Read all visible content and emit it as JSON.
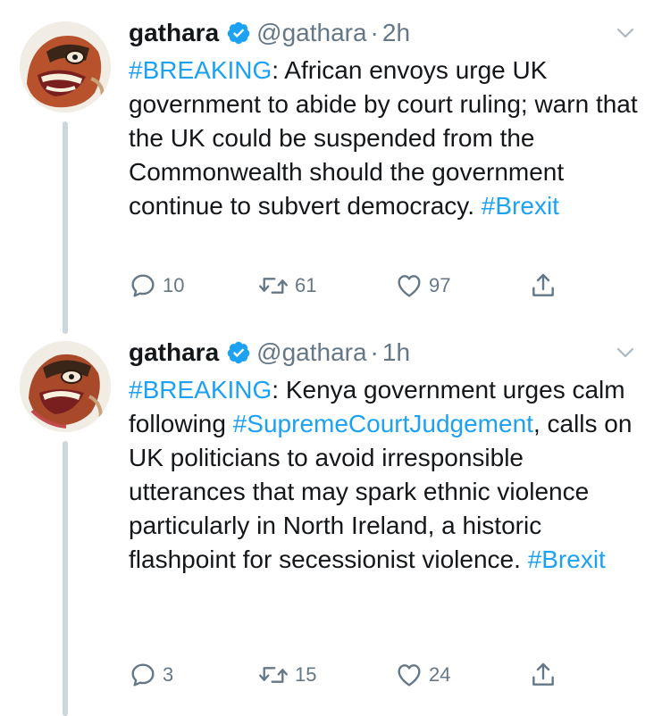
{
  "tweets": [
    {
      "name": "gathara",
      "handle": "@gathara",
      "separator": "·",
      "time": "2h",
      "segments": [
        {
          "text": "#BREAKING",
          "tag": true
        },
        {
          "text": ": African envoys urge UK government to abide by court ruling; warn that the UK could be suspended from the Commonwealth should the government continue to subvert democracy. ",
          "tag": false
        },
        {
          "text": "#Brexit",
          "tag": true
        }
      ],
      "replies": "10",
      "retweets": "61",
      "likes": "97"
    },
    {
      "name": "gathara",
      "handle": "@gathara",
      "separator": "·",
      "time": "1h",
      "segments": [
        {
          "text": "#BREAKING",
          "tag": true
        },
        {
          "text": ": Kenya government urges calm following ",
          "tag": false
        },
        {
          "text": "#SupremeCourtJudgement",
          "tag": true
        },
        {
          "text": ", calls on UK politicians to avoid irresponsible utterances that may spark ethnic violence particularly in North Ireland, a historic flashpoint for secessionist violence. ",
          "tag": false
        },
        {
          "text": "#Brexit",
          "tag": true
        }
      ],
      "replies": "3",
      "retweets": "15",
      "likes": "24"
    }
  ],
  "icons": {
    "verified": "verified-badge-icon",
    "chevron": "chevron-down-icon",
    "reply": "reply-icon",
    "retweet": "retweet-icon",
    "like": "heart-icon",
    "share": "share-icon"
  },
  "colors": {
    "link": "#1da1f2",
    "secondary": "#657786",
    "text": "#14171a",
    "thread_line": "#ccd6dd"
  }
}
